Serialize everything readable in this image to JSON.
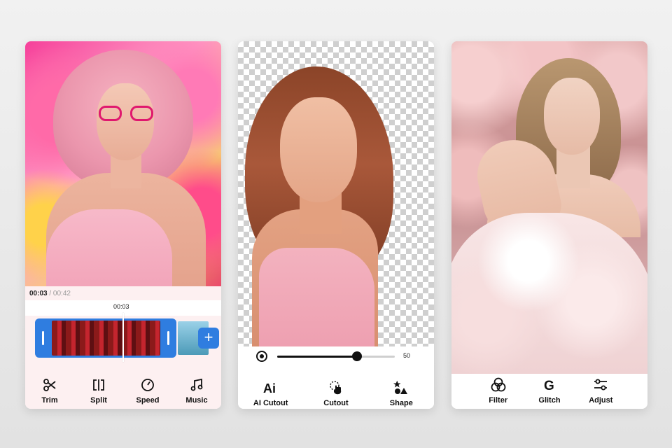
{
  "phone1": {
    "time_current": "00:03",
    "time_separator": " / ",
    "time_total": "00:42",
    "playhead_time": "00:03",
    "add_clip_label": "+",
    "tools": [
      {
        "label": "Trim",
        "icon": "scissors-icon"
      },
      {
        "label": "Split",
        "icon": "split-icon"
      },
      {
        "label": "Speed",
        "icon": "speedometer-icon"
      },
      {
        "label": "Music",
        "icon": "music-note-icon"
      }
    ]
  },
  "phone2": {
    "slider_value": "50",
    "slider_fraction": 0.68,
    "tools": [
      {
        "label": "AI Cutout",
        "icon": "ai-icon"
      },
      {
        "label": "Cutout",
        "icon": "hand-pointer-icon"
      },
      {
        "label": "Shape",
        "icon": "shapes-icon"
      }
    ]
  },
  "phone3": {
    "tools": [
      {
        "label": "Filter",
        "icon": "filter-circles-icon"
      },
      {
        "label": "Glitch",
        "icon": "glitch-g-icon"
      },
      {
        "label": "Adjust",
        "icon": "sliders-icon"
      }
    ]
  },
  "colors": {
    "accent": "#2f7de0",
    "glasses": "#e0186e"
  }
}
